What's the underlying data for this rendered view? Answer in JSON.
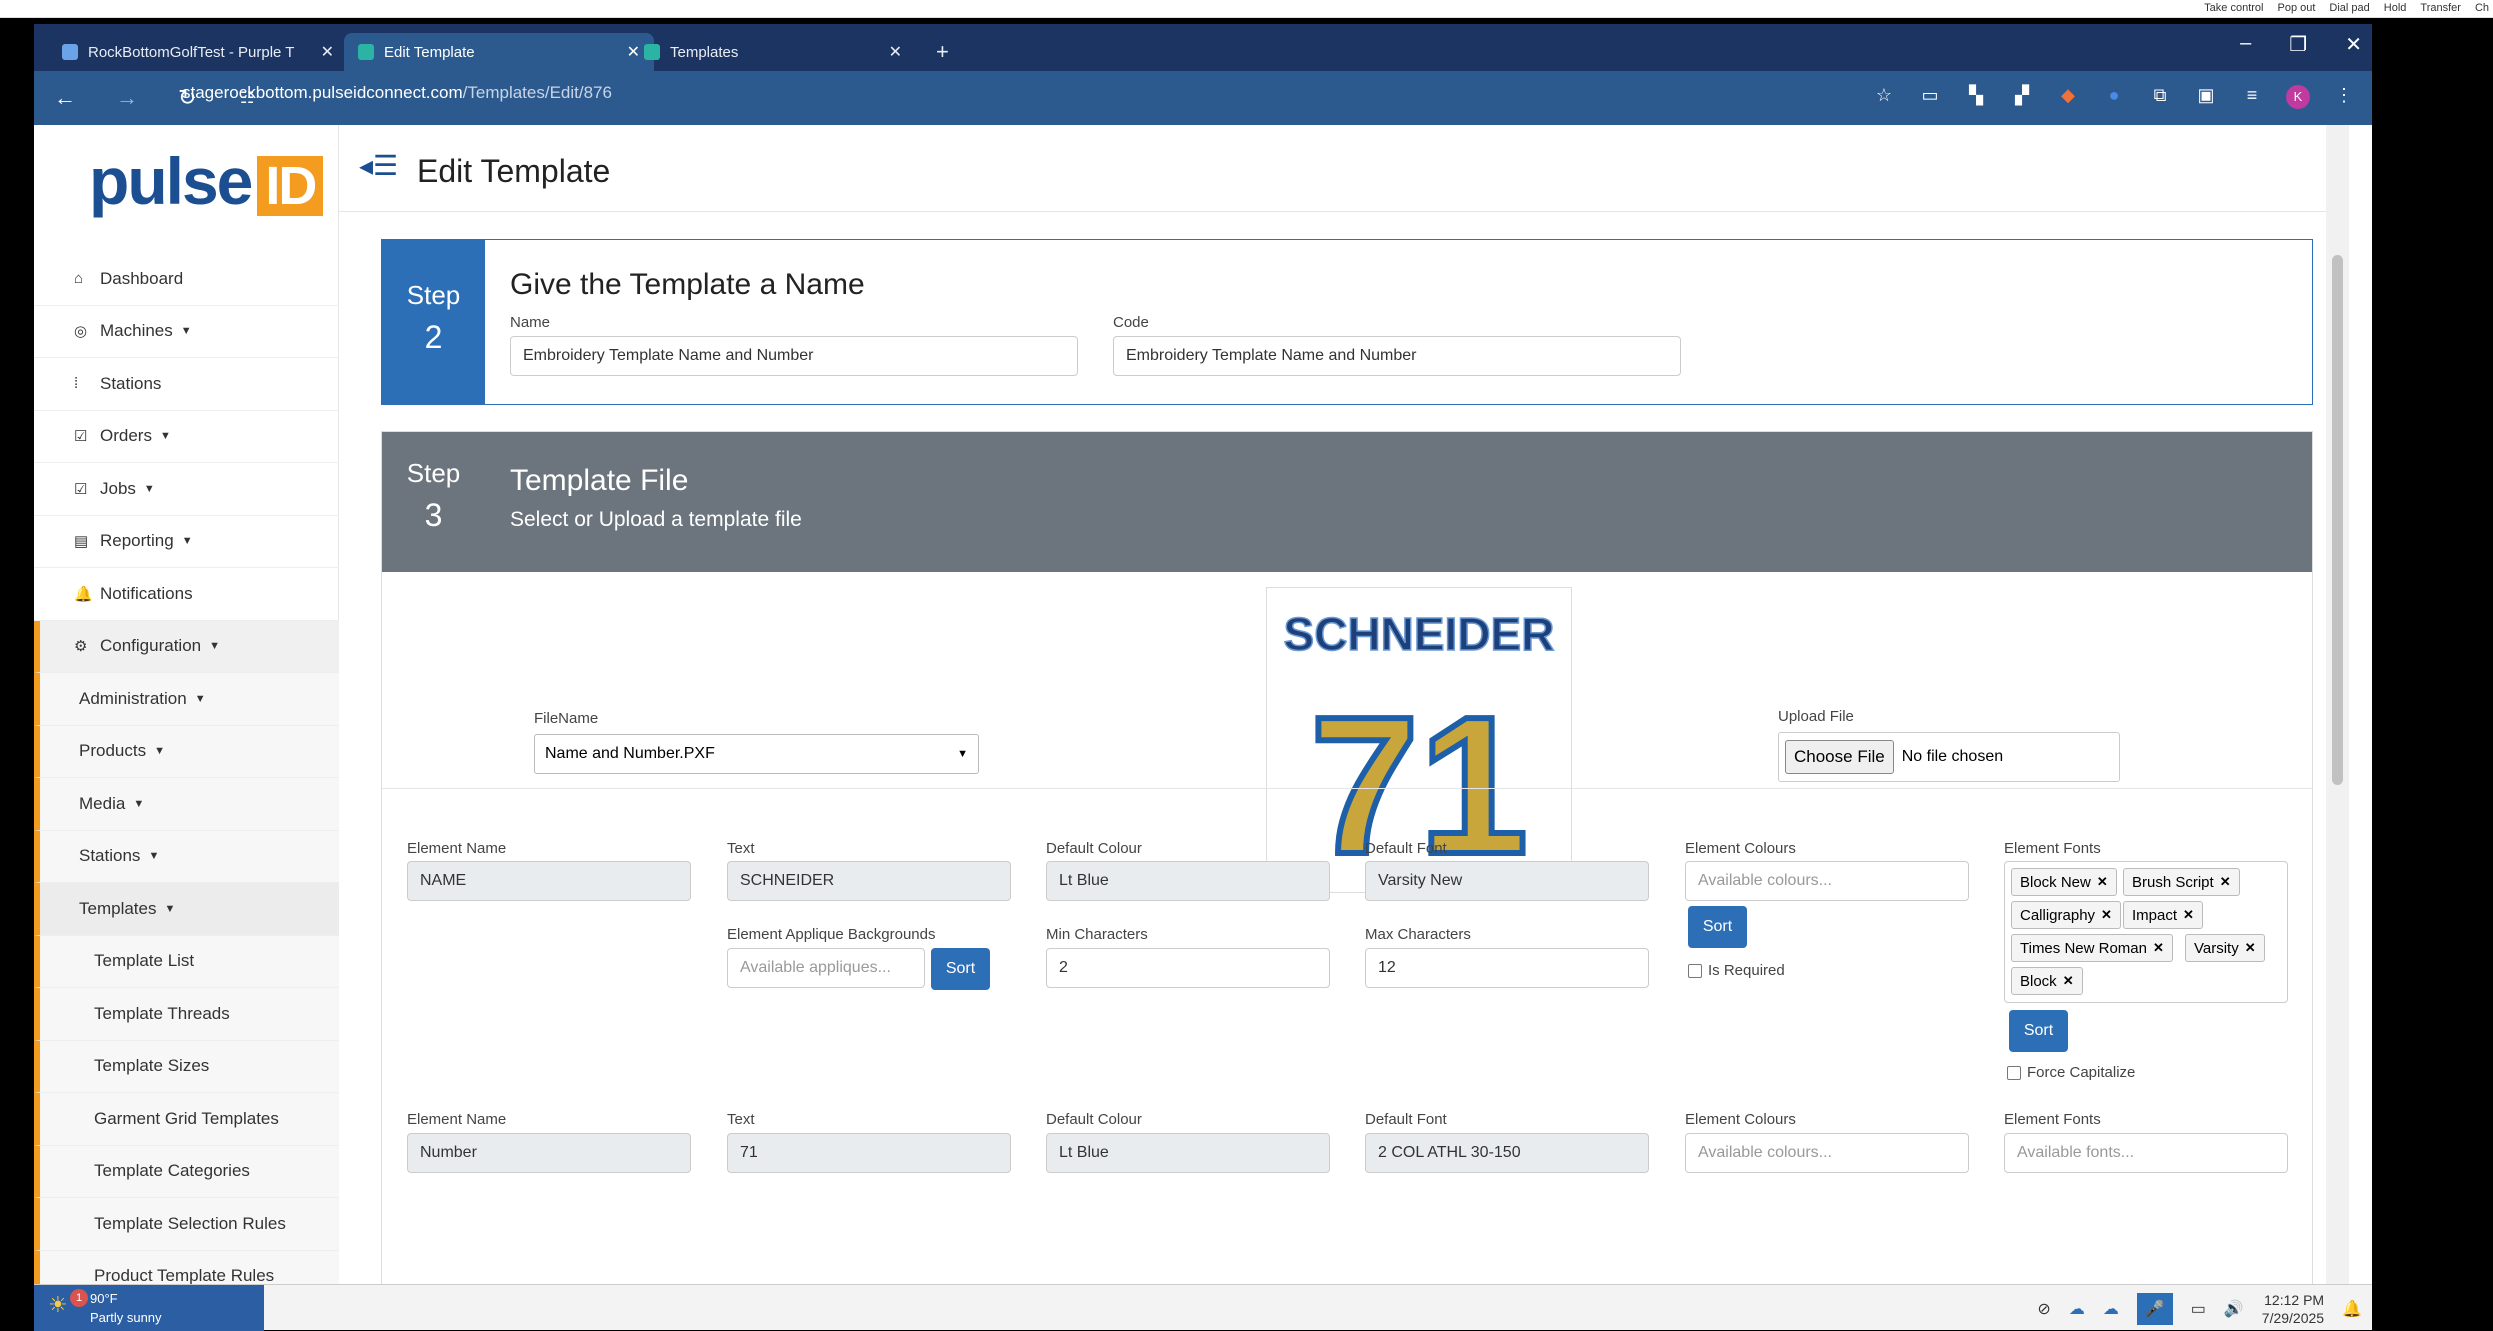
{
  "top_strip": [
    "Take control",
    "Pop out",
    "Dial pad",
    "Hold",
    "Transfer",
    "Ch"
  ],
  "tabs": [
    {
      "title": "RockBottomGolfTest - Purple T",
      "active": false
    },
    {
      "title": "Edit Template",
      "active": true
    },
    {
      "title": "Templates",
      "active": false
    }
  ],
  "new_tab": "+",
  "address": {
    "host": "stagerockbottom.pulseidconnect.com",
    "path": "/Templates/Edit/876"
  },
  "profile_initial": "K",
  "logo": {
    "text": "pulse",
    "badge": "ID",
    "colors": {
      "text": "#1c4f91",
      "badge": "#f39c1f"
    }
  },
  "menu": [
    {
      "label": "Dashboard",
      "icon": "home-icon",
      "glyph": "⌂",
      "dropdown": false
    },
    {
      "label": "Machines",
      "icon": "machine-icon",
      "glyph": "◎",
      "dropdown": true
    },
    {
      "label": "Stations",
      "icon": "stations-icon",
      "glyph": "⁞",
      "dropdown": false
    },
    {
      "label": "Orders",
      "icon": "checkbox-icon",
      "glyph": "☑",
      "dropdown": true
    },
    {
      "label": "Jobs",
      "icon": "checkbox-icon",
      "glyph": "☑",
      "dropdown": true
    },
    {
      "label": "Reporting",
      "icon": "table-icon",
      "glyph": "▤",
      "dropdown": true
    },
    {
      "label": "Notifications",
      "icon": "bell-icon",
      "glyph": "🔔",
      "dropdown": false
    },
    {
      "label": "Configuration",
      "icon": "gear-icon",
      "glyph": "⚙",
      "dropdown": true
    }
  ],
  "submenu": [
    {
      "label": "Administration",
      "dropdown": true
    },
    {
      "label": "Products",
      "dropdown": true
    },
    {
      "label": "Media",
      "dropdown": true
    },
    {
      "label": "Stations",
      "dropdown": true
    },
    {
      "label": "Templates",
      "dropdown": true
    }
  ],
  "template_menu": [
    "Template List",
    "Template Threads",
    "Template Sizes",
    "Garment Grid Templates",
    "Template Categories",
    "Template Selection Rules",
    "Product Template Rules"
  ],
  "page_title": "Edit Template",
  "step2": {
    "step_label": "Step",
    "step_num": "2",
    "title": "Give the Template a Name",
    "name_label": "Name",
    "name_value": "Embroidery Template Name and Number",
    "code_label": "Code",
    "code_value": "Embroidery Template Name and Number"
  },
  "step3": {
    "step_label": "Step",
    "step_num": "3",
    "title": "Template File",
    "subtitle": "Select or Upload a template file",
    "filename_label": "FileName",
    "filename_value": "Name and Number.PXF",
    "upload_label": "Upload File",
    "choose_btn": "Choose File",
    "no_file": "No file chosen",
    "preview": {
      "name": "SCHNEIDER",
      "number": "71"
    }
  },
  "labels": {
    "element_name": "Element Name",
    "text": "Text",
    "default_colour": "Default Colour",
    "default_font": "Default Font",
    "element_colours": "Element Colours",
    "element_fonts": "Element Fonts",
    "applique": "Element Applique Backgrounds",
    "min_chars": "Min Characters",
    "max_chars": "Max Characters",
    "sort": "Sort",
    "is_required": "Is Required",
    "force_cap": "Force Capitalize",
    "colours_ph": "Available colours...",
    "applique_ph": "Available appliques...",
    "fonts_ph": "Available fonts..."
  },
  "element1": {
    "name": "NAME",
    "text": "SCHNEIDER",
    "colour": "Lt Blue",
    "font": "Varsity New",
    "min": "2",
    "max": "12",
    "fonts": [
      "Block New",
      "Brush Script",
      "Calligraphy",
      "Impact",
      "Times New Roman",
      "Varsity",
      "Block"
    ]
  },
  "element2": {
    "name": "Number",
    "text": "71",
    "colour": "Lt Blue",
    "font": "2 COL ATHL 30-150"
  },
  "taskbar": {
    "temp": "90°F",
    "cond": "Partly sunny",
    "badge": "1",
    "time": "12:12 PM",
    "date": "7/29/2025"
  }
}
